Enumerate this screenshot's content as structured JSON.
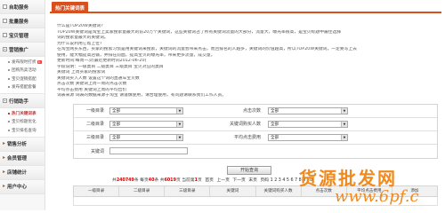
{
  "sidebar": {
    "sections": [
      {
        "label": "自助服务",
        "state": "plus"
      },
      {
        "label": "批量服务",
        "state": "plus"
      },
      {
        "label": "宝贝管理",
        "state": "plus"
      },
      {
        "label": "营销推广",
        "state": "open"
      }
    ],
    "promo_items": [
      "发布限时打折",
      "团购热卖活动",
      "宝贝促销搭配",
      "发布搭配套餐"
    ],
    "section_tools": {
      "label": "行销助手",
      "state": "open"
    },
    "tool_items": [
      "热门关键词表",
      "宝贝标题优化",
      "宝贝排名查询"
    ],
    "bottom_sections": [
      "销售分析",
      "会员管理",
      "店铺统计",
      "用户中心"
    ],
    "new_badge": "新"
  },
  "tab": {
    "label": "热门关键词表"
  },
  "intro": [
    "什么是TOP20W关键词?",
    "TOP20W关键词是淘宝上卖家搜索量最大的前20万个关键词，这些关键词占了所有关键词流量的大部分，流量大，曝光率很高，是宝贝标题中最佳选择",
    "词的搜索量最大的关键词。",
    "为什么说利用它帮上位?",
    "在淘宝网买东西，买家的搜索习惯是用关键词来搜索，关键词的流量会带来点击，而且排名的人越多，关键词的价值越高，所以TOP20W关键词，一定要写上去",
    "使用，能大幅提高店铺，并排在前面，提高宝贝的曝光率，带来更多流量，成交量。",
    "更新时间:每周一次(最近更新时间2012-06-20)",
    "字段说明：一级类目 二级类目 三级类目 宝贝对应的类目",
    "关键词 上周买家的搜索词",
    "关键词买入人数 设置这个词的直通车宝贝数",
    "点击次数 关键词上周一周的点击次数",
    "平均点击费用 关键词上周的平均出价",
    "词表来源 词表的数据来源于淘宝 请谨慎使用，请合理使用，有问题请联系我们工作人员。"
  ],
  "filters": {
    "row1": {
      "label1": "一级目录",
      "value1": "全部",
      "label2": "点击次数",
      "value2": "全部"
    },
    "row2": {
      "label1": "二级目录",
      "value1": "全部",
      "label2": "关键词购买人数",
      "value2": "全部"
    },
    "row3": {
      "label1": "三级目录",
      "value1": "全部",
      "label2": "平均点击费用",
      "value2": "全部"
    },
    "row4": {
      "label1": "关键词",
      "value1": ""
    }
  },
  "search_button": "开始查询",
  "pager": {
    "prefix": "共",
    "total": "240749",
    "total_suffix": "条 每页",
    "per_page": "40",
    "per_page_suffix": "条 共",
    "pages": "6019",
    "pages_suffix": "页 当前第",
    "current": "1",
    "current_suffix": "页",
    "links": [
      "首页",
      "上一页",
      "下一页",
      "末页"
    ],
    "numbers": "页码 1 2 3 4 5 6 7 8 9 10"
  },
  "table_headers": [
    "一级目录",
    "二级目录",
    "三级目录",
    "关键词",
    "关键词购买人数",
    "点击次数",
    "平均点击费用",
    "添加"
  ],
  "watermark": {
    "cn": "货源批发网",
    "url": "www.6pf.c"
  },
  "colors": {
    "accent": "#d9501e",
    "watermark": "#f08a1e"
  }
}
